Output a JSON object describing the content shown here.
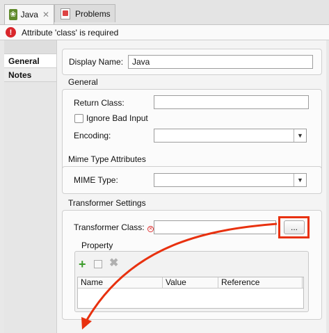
{
  "tabs": [
    {
      "label": "Java",
      "icon": "java-leaf-icon",
      "active": true
    },
    {
      "label": "Problems",
      "icon": "problems-icon",
      "active": false
    }
  ],
  "error": {
    "message": "Attribute 'class' is required"
  },
  "sidenav": {
    "items": [
      {
        "label": "General"
      },
      {
        "label": "Notes"
      }
    ]
  },
  "display_name": {
    "label": "Display Name:",
    "value": "Java"
  },
  "general": {
    "title": "General",
    "return_class": {
      "label": "Return Class:",
      "value": ""
    },
    "ignore_bad_input": {
      "label": "Ignore Bad Input",
      "checked": false
    },
    "encoding": {
      "label": "Encoding:",
      "value": ""
    }
  },
  "mime": {
    "title": "Mime Type Attributes",
    "mime_type": {
      "label": "MIME Type:",
      "value": ""
    }
  },
  "transformer": {
    "title": "Transformer Settings",
    "class_label": "Transformer Class:",
    "class_value": "",
    "browse_label": "...",
    "property": {
      "title": "Property",
      "columns": [
        "Name",
        "Value",
        "Reference"
      ]
    }
  },
  "colors": {
    "annotation": "#e8310f",
    "error": "#d9272c"
  }
}
